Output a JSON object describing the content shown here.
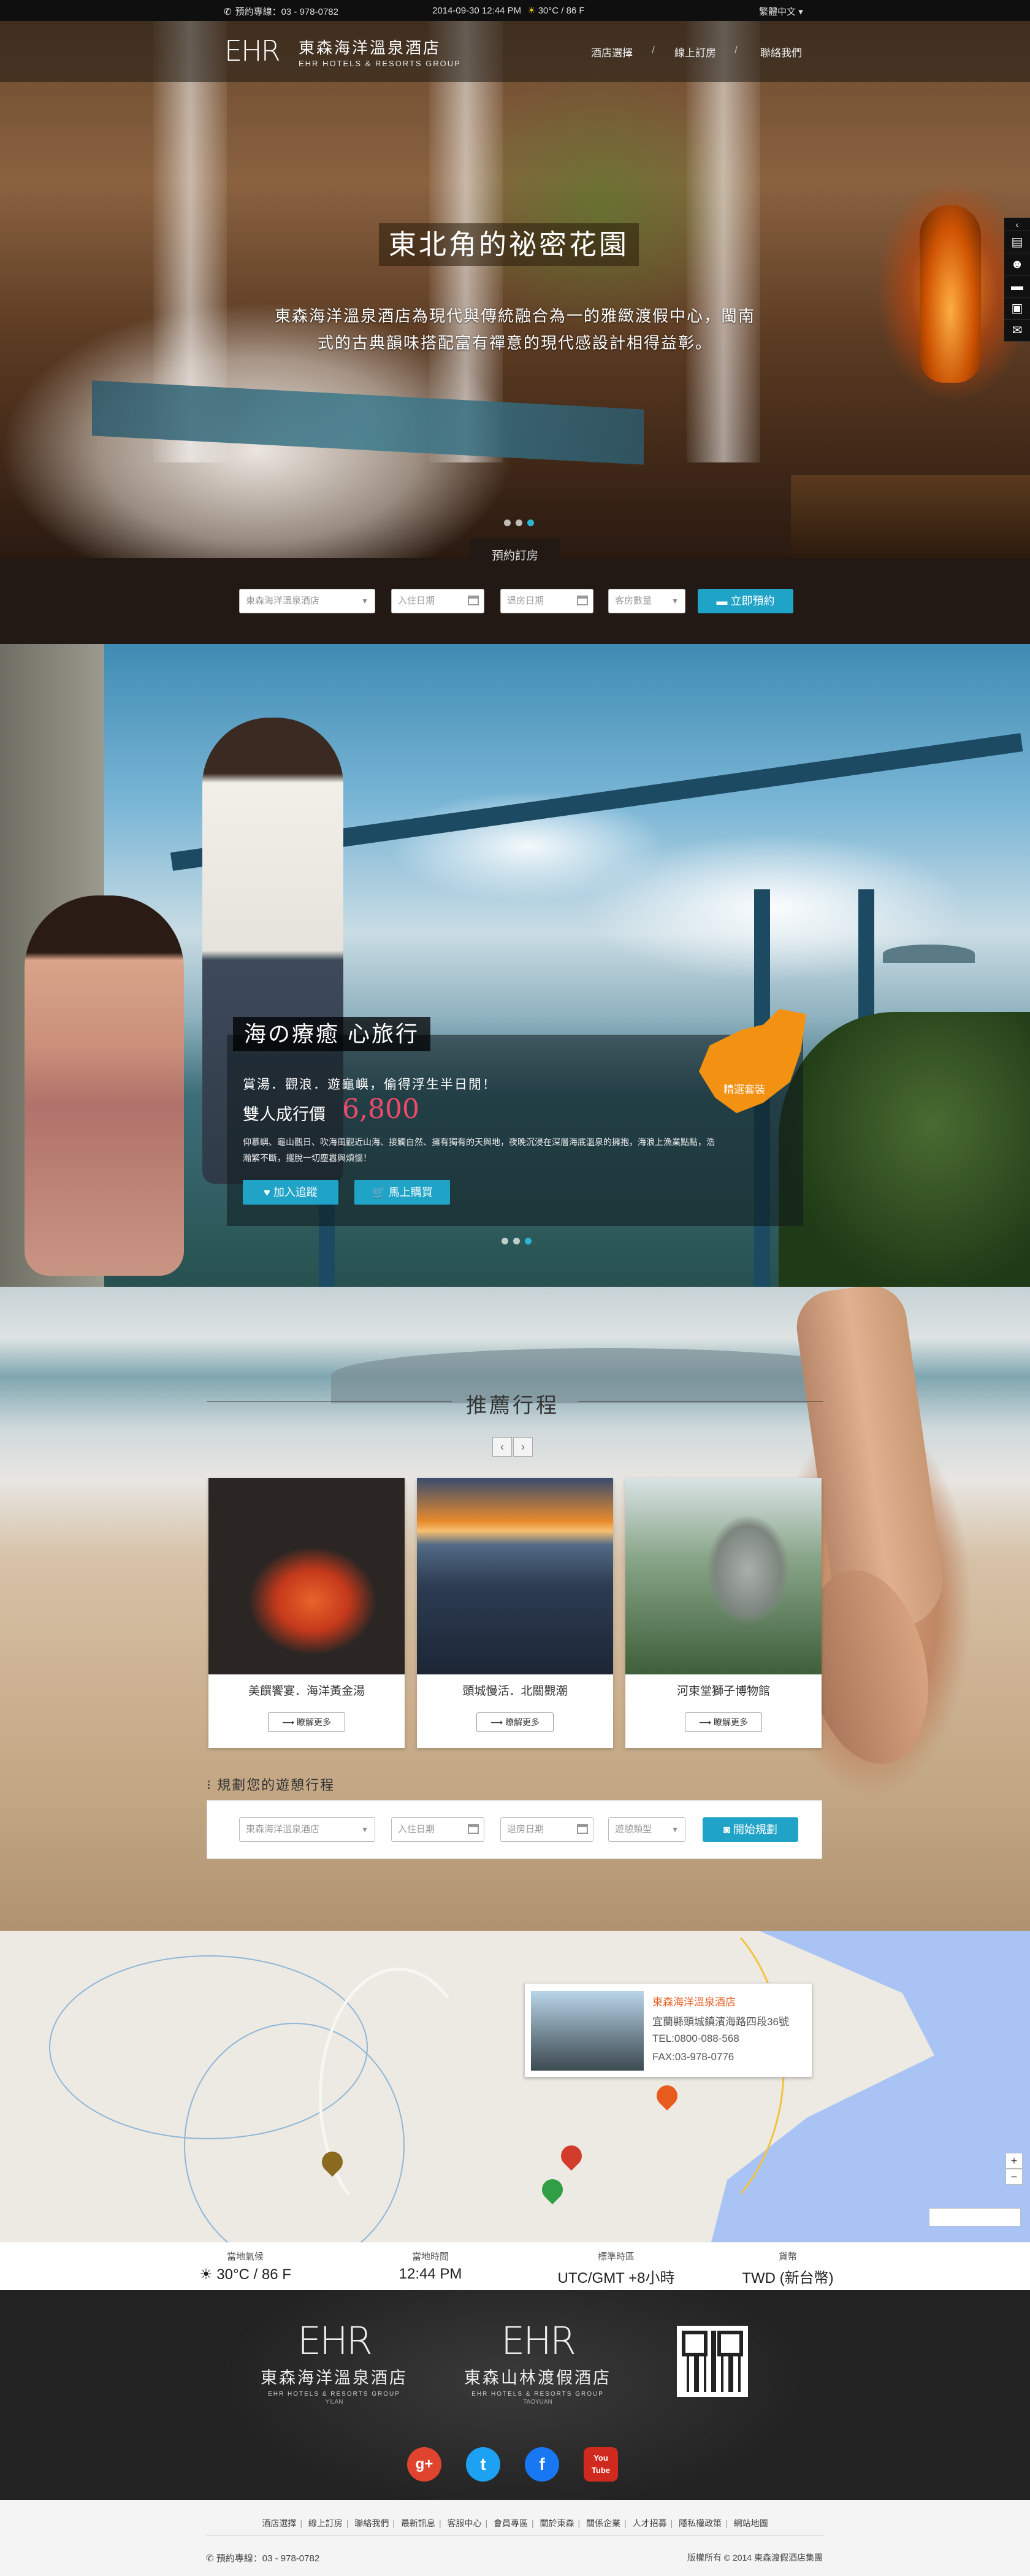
{
  "topbar": {
    "phone": "預約專線：03 - 978-0782",
    "datetime": "2014-09-30  12:44 PM",
    "weather": "30°C / 86 F",
    "language": "繁體中文"
  },
  "header": {
    "logo_mark": "EHR",
    "logo_title": "東森海洋溫泉酒店",
    "logo_sub": "EHR HOTELS & RESORTS GROUP",
    "nav": [
      "酒店選擇",
      "線上訂房",
      "聯絡我們"
    ]
  },
  "hero": {
    "title": "東北角的祕密花園",
    "desc_line1": "東森海洋溫泉酒店為現代與傳統融合為一的雅緻渡假中心，閩南",
    "desc_line2": "式的古典韻味搭配富有禪意的現代感設計相得益彰。"
  },
  "booking": {
    "tab": "預約訂房",
    "hotel_select": "東森海洋溫泉酒店",
    "checkin": "入住日期",
    "checkout": "退房日期",
    "rooms": "客房數量",
    "submit": "立即預約"
  },
  "package": {
    "title": "海の療癒 心旅行",
    "line1": "賞湯．觀浪．遊龜嶼，偷得浮生半日閒！",
    "price_label": "雙人成行價",
    "price": "6,800",
    "desc_line1": "仰慕嶼、龜山觀日、吹海風觀近山海、接觸自然、擁有獨有的天與地，夜晚沉浸在深層海底溫泉的擁抱，海浪上漁業點點，浩",
    "desc_line2": "瀚繁不斷，擺脫一切塵囂與煩惱！",
    "btn_join": "加入追蹤",
    "btn_buy": "馬上購買",
    "badge": "精選套裝"
  },
  "recommend": {
    "title": "推薦行程",
    "cards": [
      {
        "title": "美饌饗宴．海洋黃金湯",
        "more": "瞭解更多"
      },
      {
        "title": "頭城慢活．北關觀潮",
        "more": "瞭解更多"
      },
      {
        "title": "河東堂獅子博物館",
        "more": "瞭解更多"
      }
    ],
    "plan_title": "規劃您的遊憩行程",
    "plan_hotel": "東森海洋溫泉酒店",
    "plan_checkin": "入住日期",
    "plan_checkout": "退房日期",
    "plan_type": "遊憩類型",
    "plan_submit": "開始規劃"
  },
  "map": {
    "hotel_name": "東森海洋溫泉酒店",
    "address": "宜蘭縣頭城鎮濱海路四段36號",
    "tel": "TEL:0800-088-568",
    "fax": "FAX:03-978-0776"
  },
  "info": {
    "items": [
      {
        "label": "當地氣候",
        "value": "30°C / 86 F"
      },
      {
        "label": "當地時間",
        "value": "12:44 PM"
      },
      {
        "label": "標準時區",
        "value": "UTC/GMT +8小時"
      },
      {
        "label": "貨幣",
        "value": "TWD (新台幣)"
      }
    ]
  },
  "footer": {
    "brands": [
      {
        "mark": "EHR",
        "name": "東森海洋溫泉酒店",
        "en": "EHR HOTELS & RESORTS GROUP",
        "loc": "YILAN"
      },
      {
        "mark": "EHR",
        "name": "東森山林渡假酒店",
        "en": "EHR HOTELS & RESORTS GROUP",
        "loc": "TAOYUAN"
      }
    ],
    "social": [
      "g+",
      "t",
      "f",
      "You Tube"
    ],
    "links": [
      "酒店選擇",
      "線上訂房",
      "聯絡我們",
      "最新訊息",
      "客服中心",
      "會員專區",
      "關於東森",
      "關係企業",
      "人才招募",
      "隱私權政策",
      "網站地圖"
    ],
    "phone": "預約專線：03 - 978-0782",
    "copyright": "版權所有 © 2014 東森渡假酒店集團"
  },
  "colors": {
    "accent": "#1fa3c7",
    "price": "#f04a6a",
    "badge": "#f29112",
    "map_title": "#e85b1e"
  }
}
